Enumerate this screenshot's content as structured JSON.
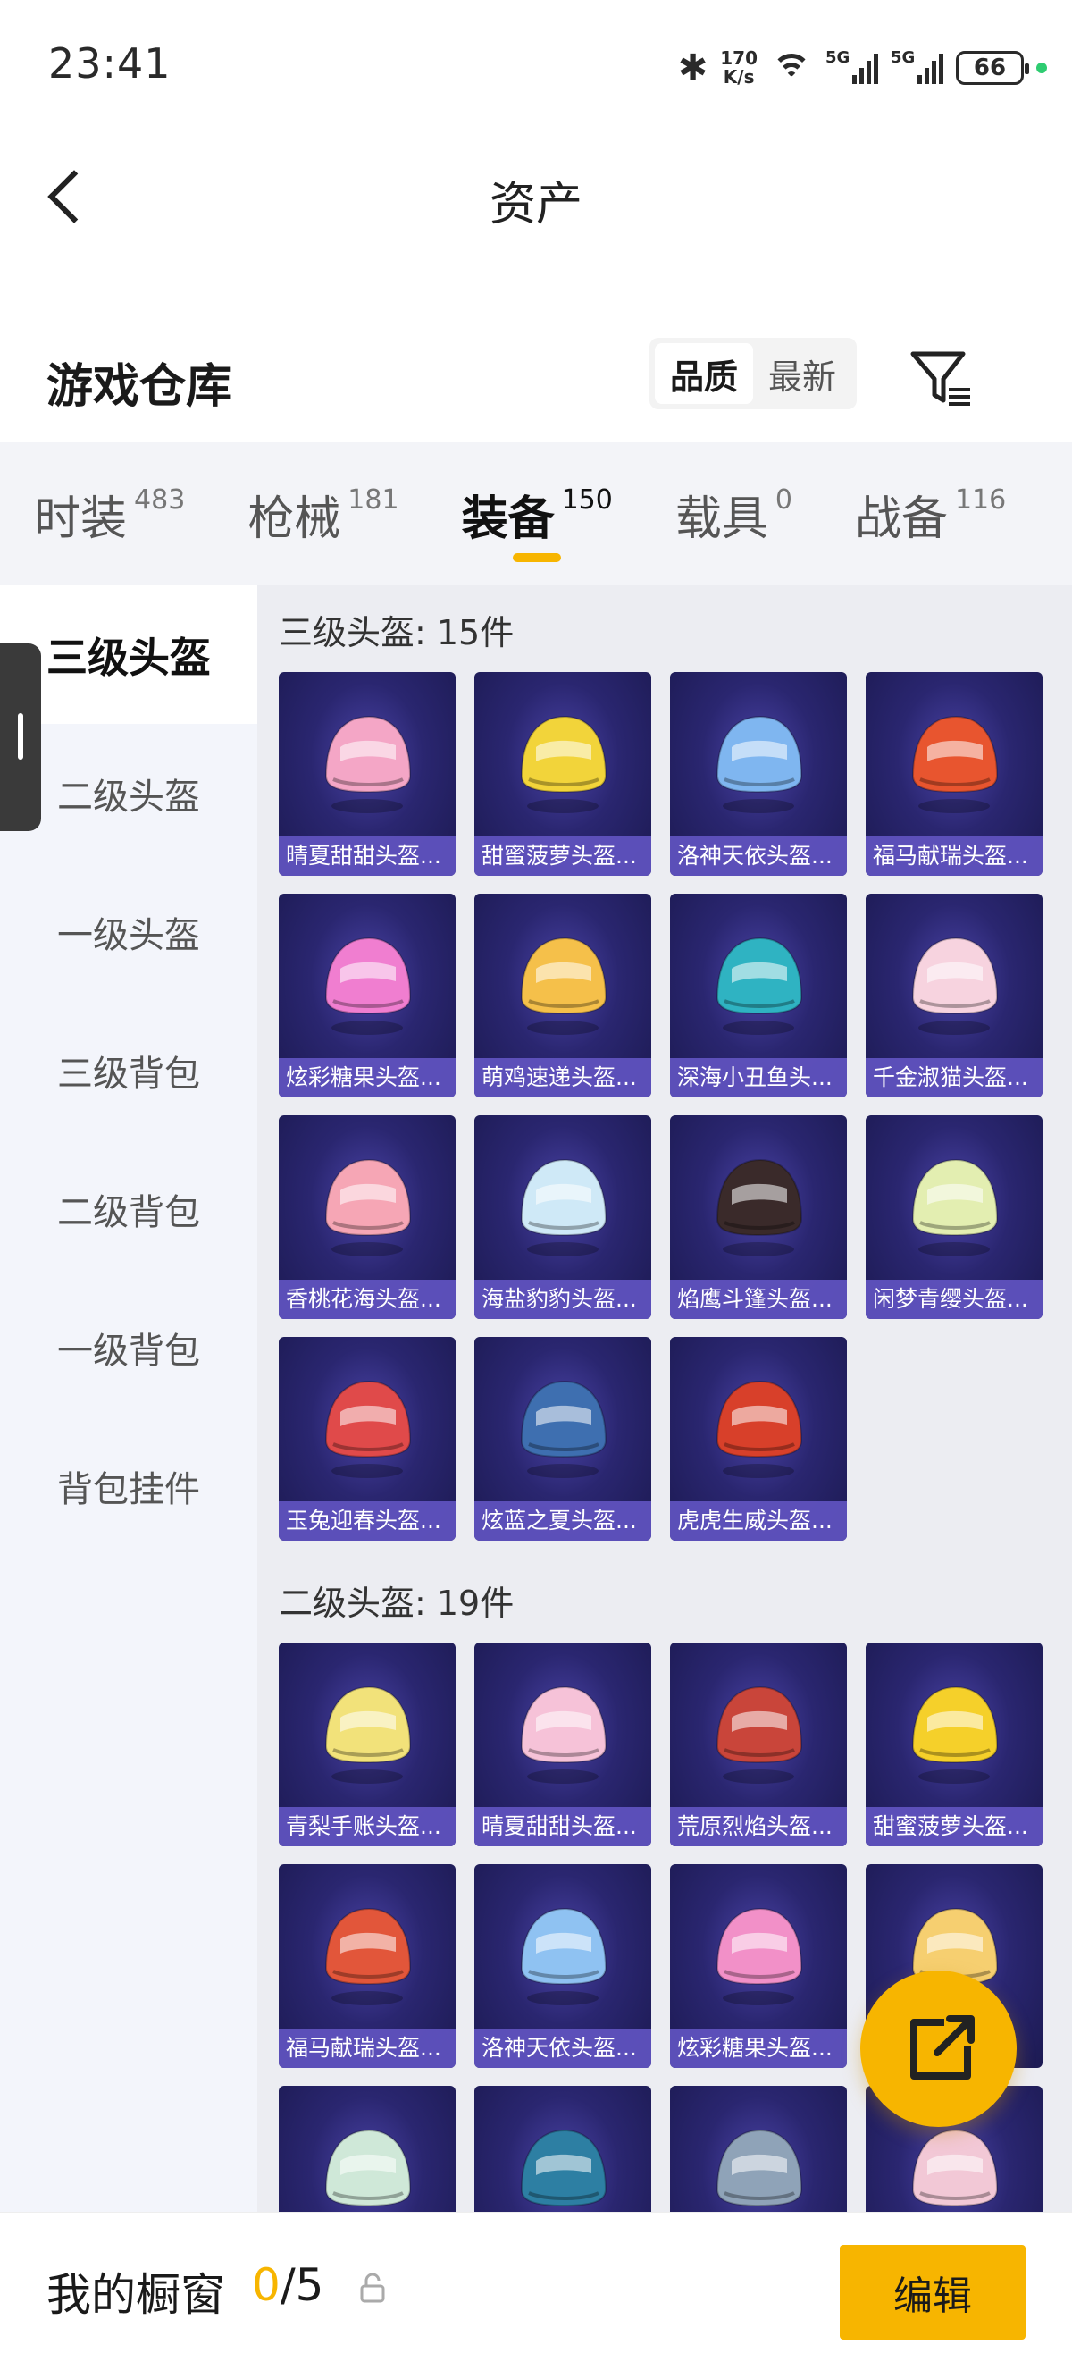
{
  "status_bar": {
    "time": "23:41",
    "net_speed_value": "170",
    "net_speed_unit": "K/s",
    "network_1": "5G",
    "network_2": "5G",
    "battery": "66"
  },
  "header": {
    "title": "资产"
  },
  "warehouse": {
    "title": "游戏仓库",
    "sort_options": [
      "品质",
      "最新"
    ],
    "active_sort": "品质"
  },
  "tabs": [
    {
      "label": "时装",
      "count": "483"
    },
    {
      "label": "枪械",
      "count": "181"
    },
    {
      "label": "装备",
      "count": "150",
      "active": true
    },
    {
      "label": "载具",
      "count": "0"
    },
    {
      "label": "战备",
      "count": "116"
    }
  ],
  "sidebar": {
    "items": [
      "三级头盔",
      "二级头盔",
      "一级头盔",
      "三级背包",
      "二级背包",
      "一级背包",
      "背包挂件"
    ],
    "active": "三级头盔"
  },
  "sections": [
    {
      "title": "三级头盔: 15件",
      "items": [
        {
          "label": "晴夏甜甜头盔...",
          "color": "#f4a6c6"
        },
        {
          "label": "甜蜜菠萝头盔...",
          "color": "#f2d43a"
        },
        {
          "label": "洛神天依头盔...",
          "color": "#7fb6f0"
        },
        {
          "label": "福马献瑞头盔...",
          "color": "#e8552f"
        },
        {
          "label": "炫彩糖果头盔...",
          "color": "#f07ed0"
        },
        {
          "label": "萌鸡速递头盔...",
          "color": "#f5c04a"
        },
        {
          "label": "深海小丑鱼头...",
          "color": "#2fb3c2"
        },
        {
          "label": "千金淑猫头盔...",
          "color": "#f7d3df"
        },
        {
          "label": "香桃花海头盔...",
          "color": "#f6a6b5"
        },
        {
          "label": "海盐豹豹头盔...",
          "color": "#cfe9f7"
        },
        {
          "label": "焰鹰斗篷头盔...",
          "color": "#3a2a2a"
        },
        {
          "label": "闲梦青缨头盔...",
          "color": "#e3eeb1"
        },
        {
          "label": "玉兔迎春头盔...",
          "color": "#e04a4a"
        },
        {
          "label": "炫蓝之夏头盔...",
          "color": "#3e6fb0"
        },
        {
          "label": "虎虎生威头盔...",
          "color": "#d8402a"
        }
      ]
    },
    {
      "title": "二级头盔: 19件",
      "items": [
        {
          "label": "青梨手账头盔...",
          "color": "#f2e27a"
        },
        {
          "label": "晴夏甜甜头盔...",
          "color": "#f6c2d8"
        },
        {
          "label": "荒原烈焰头盔...",
          "color": "#c9453a"
        },
        {
          "label": "甜蜜菠萝头盔...",
          "color": "#f5d02a"
        },
        {
          "label": "福马献瑞头盔...",
          "color": "#e2563a"
        },
        {
          "label": "洛神天依头盔...",
          "color": "#8fc2f2"
        },
        {
          "label": "炫彩糖果头盔...",
          "color": "#f290c8"
        },
        {
          "label": "",
          "color": "#f6cf70"
        },
        {
          "label": "",
          "color": "#cfe8d8"
        },
        {
          "label": "",
          "color": "#2d7fa3"
        },
        {
          "label": "",
          "color": "#8fa3b8"
        },
        {
          "label": "",
          "color": "#f2c8d6"
        }
      ]
    }
  ],
  "bottom_bar": {
    "title": "我的橱窗",
    "current": "0",
    "total": "/5",
    "edit_label": "编辑"
  },
  "colors": {
    "accent": "#f7b500",
    "card_bg": "#2a2670",
    "card_label_bg": "#5f52be"
  }
}
